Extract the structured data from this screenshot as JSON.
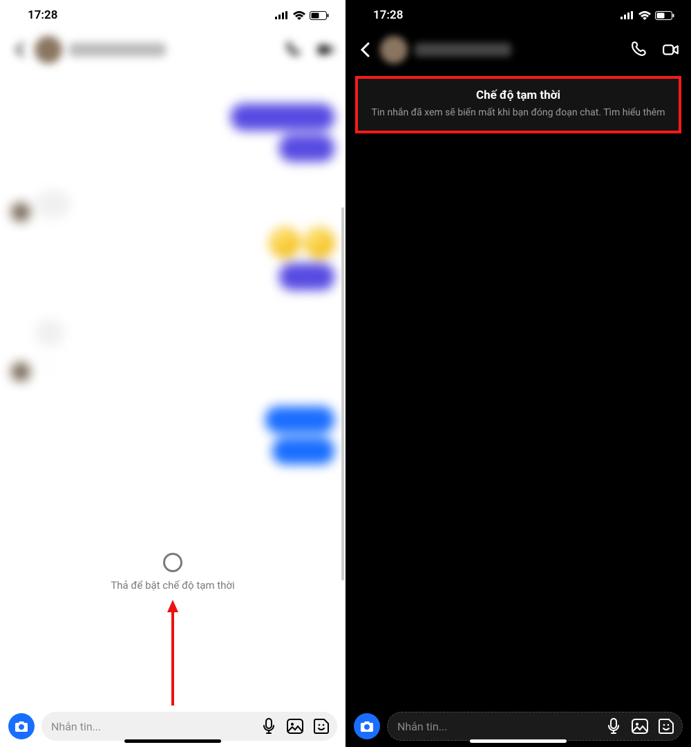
{
  "status": {
    "time": "17:28"
  },
  "left": {
    "vanish_prompt": "Thả để bật chế độ tạm thời"
  },
  "right": {
    "banner_title": "Chế độ tạm thời",
    "banner_sub_pre": "Tin nhắn đã xem sẽ biến mất khi bạn đóng đoạn chat. ",
    "banner_link": "Tìm hiểu thêm"
  },
  "composer": {
    "placeholder": "Nhắn tin..."
  }
}
